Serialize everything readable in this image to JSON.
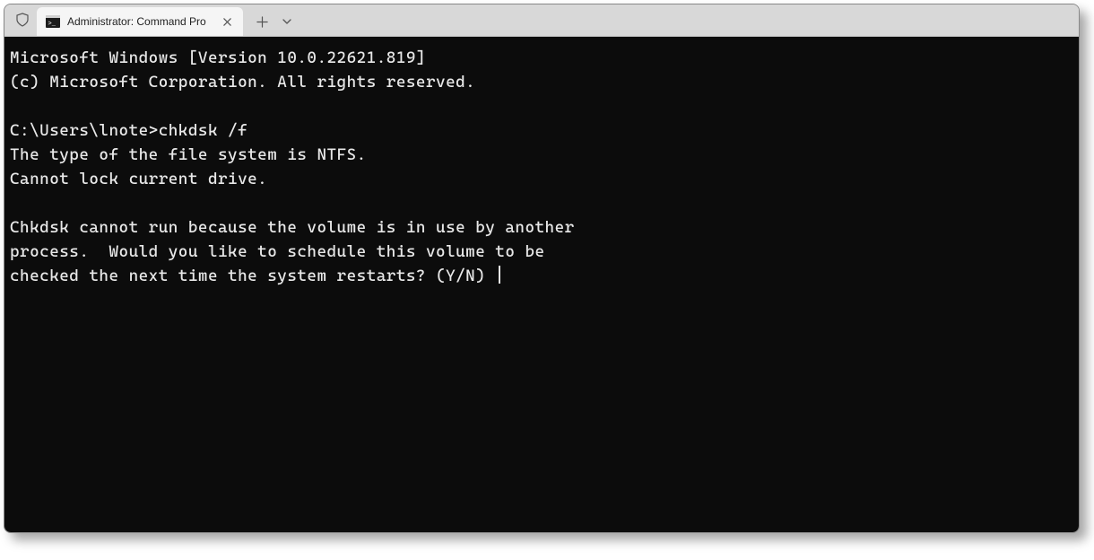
{
  "titlebar": {
    "tab_title": "Administrator: Command Pro",
    "tab_icon_name": "cmd-icon"
  },
  "terminal": {
    "line1": "Microsoft Windows [Version 10.0.22621.819]",
    "line2": "(c) Microsoft Corporation. All rights reserved.",
    "blank1": "",
    "prompt": "C:\\Users\\lnote>",
    "command": "chkdsk /f",
    "out1": "The type of the file system is NTFS.",
    "out2": "Cannot lock current drive.",
    "blank2": "",
    "out3": "Chkdsk cannot run because the volume is in use by another",
    "out4": "process.  Would you like to schedule this volume to be",
    "out5": "checked the next time the system restarts? (Y/N) "
  }
}
